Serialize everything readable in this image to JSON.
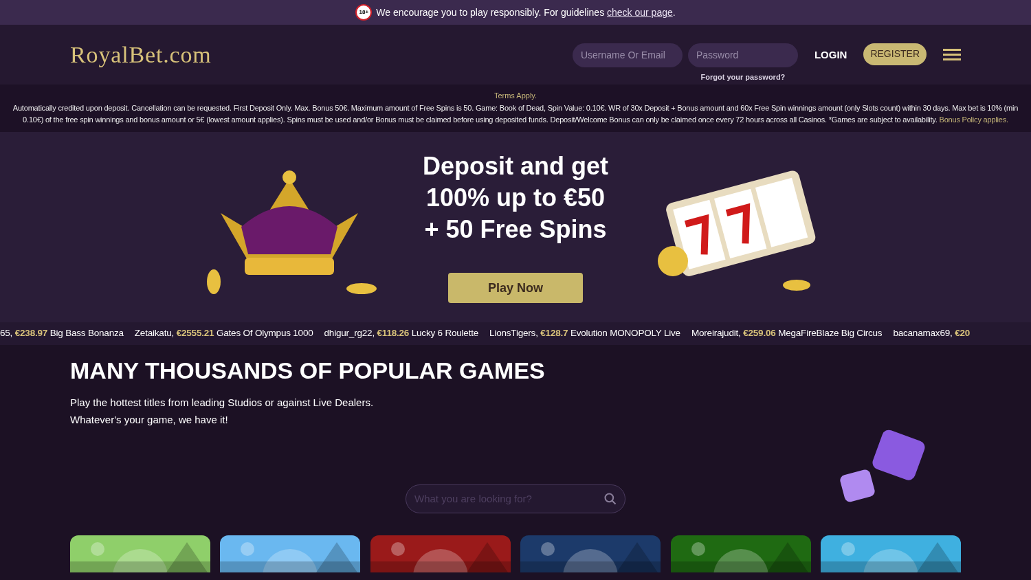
{
  "notice": {
    "badge": "18+",
    "text": "We encourage you to play responsibly. For guidelines ",
    "link": "check our page",
    "end": "."
  },
  "header": {
    "logo": "RoyalBet.com",
    "username": {
      "placeholder": "Username Or Email"
    },
    "password": {
      "placeholder": "Password"
    },
    "forgot": "Forgot your password?",
    "login": "LOGIN",
    "register": "REGISTER"
  },
  "terms": {
    "title": "Terms Apply.",
    "body": "Automatically credited upon deposit. Cancellation can be requested. First Deposit Only. Max. Bonus 50€. Maximum amount of Free Spins is 50. Game: Book of Dead, Spin Value: 0.10€. WR of 30x Deposit + Bonus amount and 60x Free Spin winnings amount (only Slots count) within 30 days. Max bet is 10% (min 0.10€) of the free spin winnings and bonus amount or 5€ (lowest amount applies). Spins must be used and/or Bonus must be claimed before using deposited funds. Deposit/Welcome Bonus can only be claimed once every 72 hours across all Casinos. *Games are subject to availability. ",
    "link": "Bonus Policy applies."
  },
  "banner": {
    "lines": [
      "Deposit and get",
      "100% up to €50",
      "+ 50 Free Spins"
    ],
    "button": "Play Now"
  },
  "winners": [
    {
      "player": "65,",
      "amount": "€238.97",
      "game": "Big Bass Bonanza"
    },
    {
      "player": "Zetaikatu,",
      "amount": "€2555.21",
      "game": "Gates Of Olympus 1000"
    },
    {
      "player": "dhigur_rg22,",
      "amount": "€118.26",
      "game": "Lucky 6 Roulette"
    },
    {
      "player": "LionsTigers,",
      "amount": "€128.7",
      "game": "Evolution MONOPOLY Live"
    },
    {
      "player": "Moreirajudit,",
      "amount": "€259.06",
      "game": "MegaFireBlaze Big Circus"
    },
    {
      "player": "bacanamax69,",
      "amount": "€20"
    }
  ],
  "games_section": {
    "title": "MANY THOUSANDS OF POPULAR GAMES",
    "lines": [
      "Play the hottest titles from leading Studios or against Live Dealers.",
      "Whatever's your game, we have it!"
    ],
    "search": {
      "placeholder": "What you are looking for?"
    }
  }
}
